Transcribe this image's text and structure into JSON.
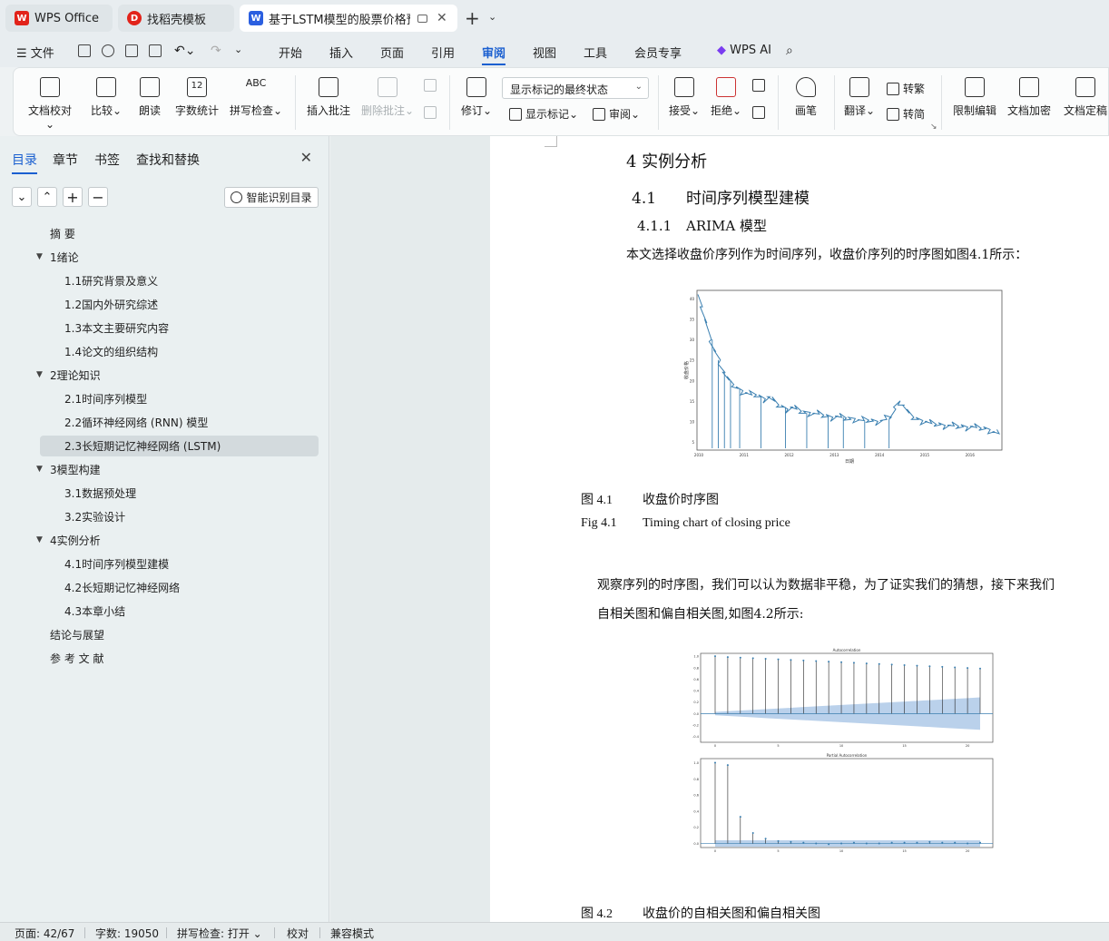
{
  "tabs": [
    {
      "label": "WPS Office"
    },
    {
      "label": "找稻壳模板"
    },
    {
      "label": "基于LSTM模型的股票价格预测"
    }
  ],
  "menu": {
    "file": "文件",
    "items": [
      "开始",
      "插入",
      "页面",
      "引用",
      "审阅",
      "视图",
      "工具",
      "会员专享"
    ],
    "active": "审阅",
    "ai": "WPS AI"
  },
  "ribbon": {
    "proofread": "文档校对",
    "compare": "比较",
    "read_aloud": "朗读",
    "word_count": "字数统计",
    "word_count_icon_text": "12",
    "spell_check": "拼写检查",
    "spell_icon_text": "ABC",
    "insert_comment": "插入批注",
    "delete_comment": "删除批注",
    "revise": "修订",
    "markup_select": "显示标记的最终状态",
    "show_markup": "显示标记",
    "review": "审阅",
    "accept": "接受",
    "reject": "拒绝",
    "pen": "画笔",
    "translate": "翻译",
    "to_traditional": "转繁",
    "to_simplified": "转简",
    "restrict_edit": "限制编辑",
    "encrypt": "文档加密",
    "finalize": "文档定稿"
  },
  "nav": {
    "tabs": [
      "目录",
      "章节",
      "书签",
      "查找和替换"
    ],
    "smart_toc": "智能识别目录",
    "toc": [
      {
        "label": "摘  要",
        "level": 1,
        "arrow": false
      },
      {
        "label": "1绪论",
        "level": 1,
        "arrow": true
      },
      {
        "label": "1.1研究背景及意义",
        "level": 2,
        "arrow": false
      },
      {
        "label": "1.2国内外研究综述",
        "level": 2,
        "arrow": false
      },
      {
        "label": "1.3本文主要研究内容",
        "level": 2,
        "arrow": false
      },
      {
        "label": "1.4论文的组织结构",
        "level": 2,
        "arrow": false
      },
      {
        "label": "2理论知识",
        "level": 1,
        "arrow": true
      },
      {
        "label": "2.1时间序列模型",
        "level": 2,
        "arrow": false
      },
      {
        "label": "2.2循环神经网络 (RNN) 模型",
        "level": 2,
        "arrow": false
      },
      {
        "label": "2.3长短期记忆神经网络 (LSTM)",
        "level": 2,
        "arrow": false,
        "selected": true
      },
      {
        "label": "3模型构建",
        "level": 1,
        "arrow": true
      },
      {
        "label": "3.1数据预处理",
        "level": 2,
        "arrow": false
      },
      {
        "label": "3.2实验设计",
        "level": 2,
        "arrow": false
      },
      {
        "label": "4实例分析",
        "level": 1,
        "arrow": true
      },
      {
        "label": "4.1时间序列模型建模",
        "level": 2,
        "arrow": false
      },
      {
        "label": "4.2长短期记忆神经网络",
        "level": 2,
        "arrow": false
      },
      {
        "label": "4.3本章小结",
        "level": 2,
        "arrow": false
      },
      {
        "label": "结论与展望",
        "level": 1,
        "arrow": false
      },
      {
        "label": "参 考 文 献",
        "level": 1,
        "arrow": false
      }
    ]
  },
  "doc": {
    "h1": "4  实例分析",
    "h2_num": "4.1",
    "h2_text": "时间序列模型建模",
    "h3_num": "4.1.1",
    "h3_text": "ARIMA 模型",
    "para1": "本文选择收盘价序列作为时间序列，收盘价序列的时序图如图4.1所示：",
    "fig1_cn_num": "图 4.1",
    "fig1_cn": "收盘价时序图",
    "fig1_en_num": "Fig 4.1",
    "fig1_en": "Timing chart of closing price",
    "para2_l1": "观察序列的时序图，我们可以认为数据非平稳，为了证实我们的猜想，接下来我们",
    "para2_l2": "自相关图和偏自相关图,如图4.2所示:",
    "fig2_cn_num": "图 4.2",
    "fig2_cn": "收盘价的自相关图和偏自相关图",
    "fig1_ylabel": "收盘价格",
    "fig1_xlabel": "日期",
    "fig2_top_title": "Autocorrelation",
    "fig2_bottom_title": "Partial Autocorrelation"
  },
  "chart_data": [
    {
      "type": "line",
      "title": "",
      "xlabel": "日期",
      "ylabel": "收盘价格",
      "yticks": [
        "40",
        "35",
        "30",
        "25",
        "20",
        "15",
        "10",
        "5"
      ],
      "xticks": [
        "2010",
        "2011",
        "2012",
        "2013",
        "2014",
        "2015",
        "2016"
      ],
      "ylim": [
        3,
        42
      ],
      "series": [
        {
          "values": [
            41,
            38,
            34,
            30,
            27,
            25,
            22,
            20,
            19,
            18,
            17.5,
            17,
            16.5,
            16.5,
            16,
            15.5,
            16,
            15,
            14,
            13.5,
            13,
            13.5,
            13,
            12.5,
            12,
            12.2,
            12,
            11.8,
            11.5,
            11.2,
            11,
            11.3,
            11,
            10.8,
            10.5,
            10.7,
            10.4,
            10.2,
            10.3,
            10.1,
            10,
            10.2,
            10.5,
            11,
            13,
            15,
            14,
            12,
            11,
            10.5,
            10.2,
            10,
            9.5,
            9.3,
            9.2,
            9,
            9.1,
            8.9,
            8.8,
            8.7,
            8.6,
            8.8,
            8.5,
            8.3,
            8.2,
            8,
            7.5,
            7
          ]
        }
      ],
      "spikes": [
        0.05,
        0.07,
        0.09,
        0.11,
        0.14,
        0.21,
        0.29,
        0.36,
        0.43,
        0.48,
        0.55,
        0.63
      ]
    },
    {
      "type": "bar",
      "title": "Autocorrelation",
      "yticks": [
        "1.0",
        "0.8",
        "0.6",
        "0.4",
        "0.2",
        "0.0",
        "-0.2",
        "-0.4"
      ],
      "xticks": [
        "0",
        "5",
        "10",
        "15",
        "20"
      ],
      "ylim": [
        -0.5,
        1.05
      ],
      "values": [
        1.0,
        0.985,
        0.975,
        0.965,
        0.955,
        0.945,
        0.935,
        0.925,
        0.915,
        0.905,
        0.895,
        0.885,
        0.875,
        0.865,
        0.855,
        0.845,
        0.835,
        0.825,
        0.815,
        0.805,
        0.795,
        0.785
      ]
    },
    {
      "type": "bar",
      "title": "Partial Autocorrelation",
      "yticks": [
        "1.0",
        "0.8",
        "0.6",
        "0.4",
        "0.2",
        "0.0"
      ],
      "xticks": [
        "0",
        "5",
        "10",
        "15",
        "20"
      ],
      "ylim": [
        -0.05,
        1.05
      ],
      "values": [
        1.0,
        0.97,
        0.33,
        0.13,
        0.06,
        0.03,
        0.02,
        0.01,
        0.0,
        -0.01,
        0.0,
        0.01,
        0.0,
        0.0,
        0.01,
        0.01,
        0.01,
        0.02,
        0.01,
        0.01,
        0.0,
        0.01
      ]
    }
  ],
  "status": {
    "page": "页面: 42/67",
    "words": "字数: 19050",
    "spell": "拼写检查: 打开",
    "proof": "校对",
    "compat": "兼容模式"
  },
  "colors": {
    "accent": "#1a5fd0",
    "line": "#3a7fb0",
    "band": "#a9c6e6"
  }
}
